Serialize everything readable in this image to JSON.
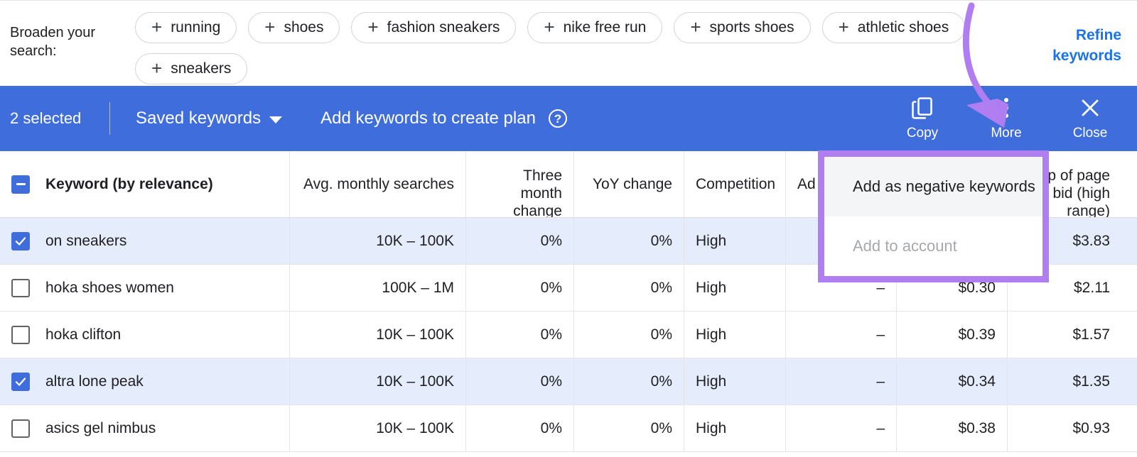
{
  "broaden": {
    "label": "Broaden your search:",
    "chips": [
      {
        "label": "running",
        "icon": "plus-icon"
      },
      {
        "label": "shoes",
        "icon": "plus-icon"
      },
      {
        "label": "fashion sneakers",
        "icon": "plus-icon"
      },
      {
        "label": "nike free run",
        "icon": "plus-icon"
      },
      {
        "label": "sports shoes",
        "icon": "plus-icon"
      },
      {
        "label": "athletic shoes",
        "icon": "plus-icon"
      },
      {
        "label": "sneakers",
        "icon": "plus-icon"
      }
    ],
    "refine_link": "Refine keywords"
  },
  "action_bar": {
    "selected_count": "2 selected",
    "saved_keywords": "Saved keywords",
    "add_keywords": "Add keywords to create plan",
    "help_glyph": "?",
    "actions": [
      {
        "label": "Copy",
        "icon": "copy-icon"
      },
      {
        "label": "More",
        "icon": "more-vert-icon"
      },
      {
        "label": "Close",
        "icon": "close-icon"
      }
    ],
    "close_glyph": "✕",
    "bg_color": "#3f6ddc"
  },
  "menu": {
    "items": [
      {
        "label": "Add as negative keywords",
        "state": "hover"
      },
      {
        "label": "Add to account",
        "state": "disabled"
      }
    ],
    "highlight_color": "#b07ef0"
  },
  "table": {
    "headers": {
      "keyword": "Keyword (by relevance)",
      "avg_monthly": "Avg. monthly searches",
      "three_month_l1": "Three month",
      "three_month_l2": "change",
      "yoy": "YoY change",
      "competition": "Competition",
      "ad_impr": "Ad",
      "top_bid_l1": "p of page",
      "top_bid_l2": "bid (high",
      "top_bid_l3": "range)"
    },
    "rows": [
      {
        "keyword": "on sneakers",
        "avg": "10K – 100K",
        "three_month": "0%",
        "yoy": "0%",
        "competition": "High",
        "ad_impr": "",
        "low_bid": "",
        "high_bid": "$3.83",
        "selected": true
      },
      {
        "keyword": "hoka shoes women",
        "avg": "100K – 1M",
        "three_month": "0%",
        "yoy": "0%",
        "competition": "High",
        "ad_impr": "–",
        "low_bid": "$0.30",
        "high_bid": "$2.11",
        "selected": false
      },
      {
        "keyword": "hoka clifton",
        "avg": "10K – 100K",
        "three_month": "0%",
        "yoy": "0%",
        "competition": "High",
        "ad_impr": "–",
        "low_bid": "$0.39",
        "high_bid": "$1.57",
        "selected": false
      },
      {
        "keyword": "altra lone peak",
        "avg": "10K – 100K",
        "three_month": "0%",
        "yoy": "0%",
        "competition": "High",
        "ad_impr": "–",
        "low_bid": "$0.34",
        "high_bid": "$1.35",
        "selected": true
      },
      {
        "keyword": "asics gel nimbus",
        "avg": "10K – 100K",
        "three_month": "0%",
        "yoy": "0%",
        "competition": "High",
        "ad_impr": "–",
        "low_bid": "$0.38",
        "high_bid": "$0.93",
        "selected": false
      }
    ]
  },
  "annotation": {
    "arrow_color": "#b07ef0"
  }
}
